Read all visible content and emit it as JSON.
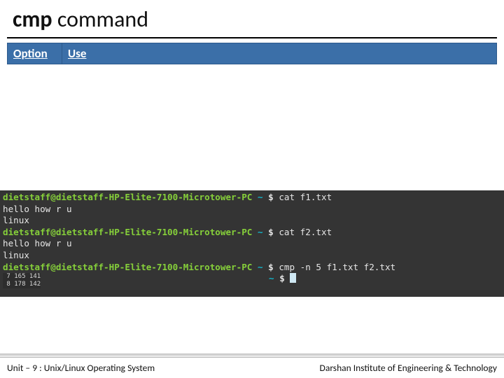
{
  "title": {
    "bold": "cmp",
    "rest": " command"
  },
  "table": {
    "headers": {
      "option": "Option",
      "use": "Use"
    }
  },
  "terminal": {
    "prompt_user": "dietstaff@dietstaff-HP-Elite-7100-Microtower-PC",
    "prompt_tilde": "~",
    "prompt_dollar": "$",
    "lines": [
      {
        "type": "cmd",
        "text": "cat f1.txt"
      },
      {
        "type": "out",
        "text": "hello how r u"
      },
      {
        "type": "out",
        "text": "linux"
      },
      {
        "type": "cmd",
        "text": "cat f2.txt"
      },
      {
        "type": "out",
        "text": "hello how r u"
      },
      {
        "type": "out",
        "text": "linux"
      },
      {
        "type": "cmd",
        "text": "cmp -n 5 f1.txt f2.txt"
      },
      {
        "type": "overlay",
        "text1": " 7 165 141",
        "text2": " 8 178 142"
      }
    ]
  },
  "footer": {
    "left": "Unit – 9  : Unix/Linux Operating System",
    "right": "Darshan Institute of Engineering & Technology"
  }
}
